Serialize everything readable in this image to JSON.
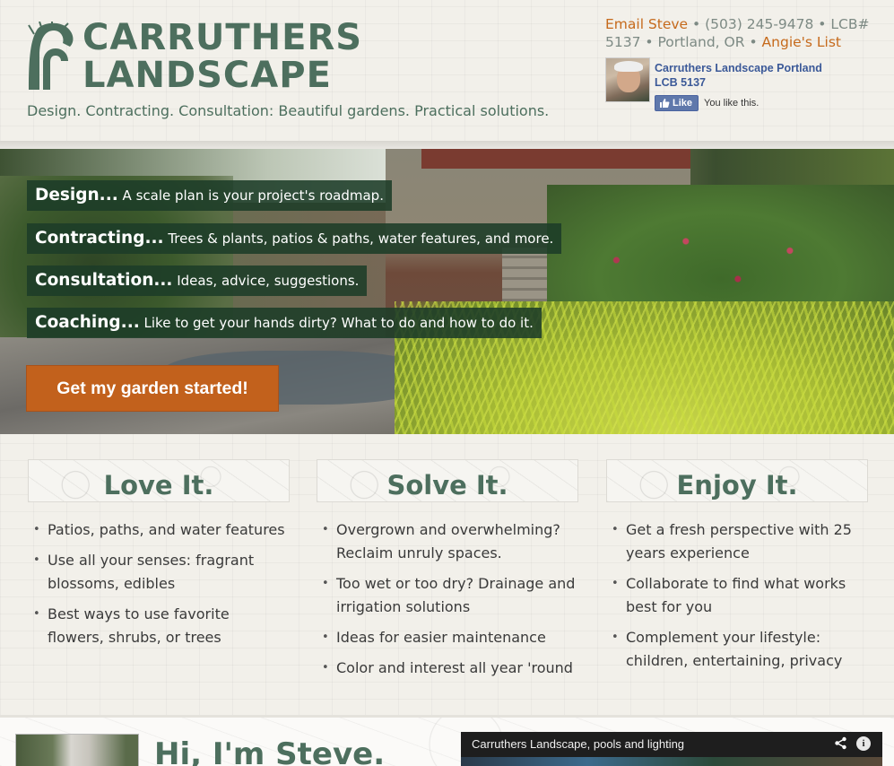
{
  "header": {
    "logo_line1": "CARRUTHERS",
    "logo_line2": "LANDSCAPE",
    "tagline": "Design. Contracting. Consultation: Beautiful gardens. Practical solutions.",
    "contact": {
      "email_label": "Email Steve",
      "phone": "(503) 245-9478",
      "lcb_prefix": "LCB#",
      "lcb_number": "5137",
      "city": "Portland, OR",
      "angies_label": "Angie's List",
      "separator": "•"
    },
    "facebook": {
      "page_name_line1": "Carruthers Landscape Portland",
      "page_name_line2": "LCB 5137",
      "like_label": "Like",
      "like_status": "You like this."
    }
  },
  "hero": {
    "lines": [
      {
        "bold": "Design...",
        "text": " A scale plan is your project's roadmap."
      },
      {
        "bold": "Contracting...",
        "text": " Trees & plants, patios & paths, water features, and more."
      },
      {
        "bold": "Consultation...",
        "text": " Ideas, advice, suggestions."
      },
      {
        "bold": "Coaching...",
        "text": " Like to get your hands dirty? What to do and how to do it."
      }
    ],
    "cta_label": "Get my garden started!"
  },
  "columns": [
    {
      "title": "Love It.",
      "items": [
        "Patios, paths, and water features",
        "Use all your senses: fragrant blossoms, edibles",
        "Best ways to use favorite flowers, shrubs, or trees"
      ]
    },
    {
      "title": "Solve It.",
      "items": [
        "Overgrown and overwhelming? Reclaim unruly spaces.",
        "Too wet or too dry? Drainage and irrigation solutions",
        "Ideas for easier maintenance",
        "Color and interest all year 'round"
      ]
    },
    {
      "title": "Enjoy It.",
      "items": [
        "Get a fresh perspective with 25 years experience",
        "Collaborate to find what works best for you",
        "Complement your lifestyle: children, entertaining, privacy"
      ]
    }
  ],
  "bottom": {
    "heading": "Hi, I'm Steve.",
    "video_title": "Carruthers Landscape, pools and lighting",
    "share_icon": "share-icon",
    "info_icon": "info-icon"
  },
  "colors": {
    "brand_green": "#4d6f5e",
    "accent_orange": "#c2611c",
    "link_orange": "#c66a1c",
    "facebook_blue": "#3b5998"
  }
}
